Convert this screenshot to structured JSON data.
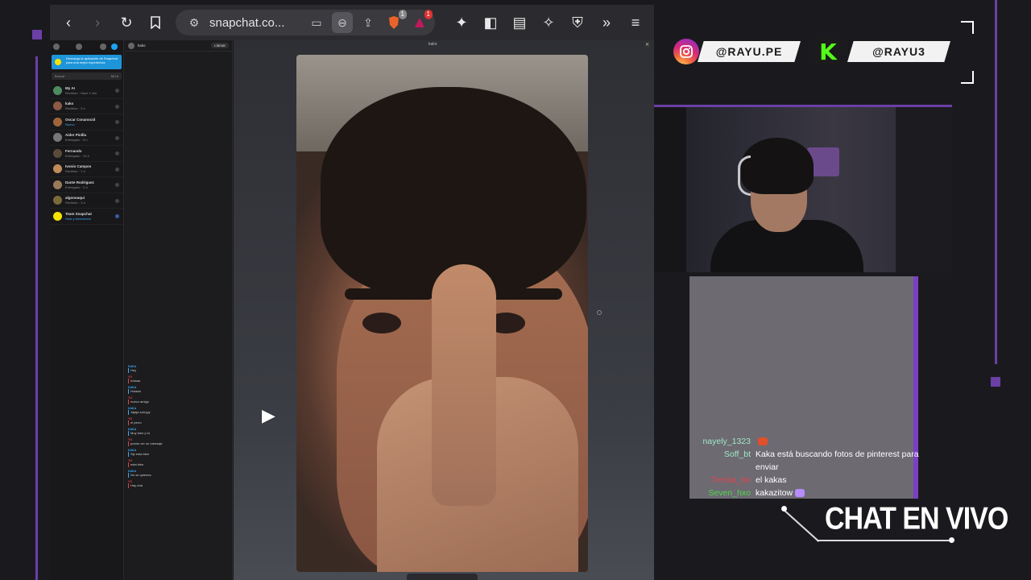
{
  "browser": {
    "url": "snapchat.co...",
    "ext_badge_1": "1",
    "ext_badge_2": "1"
  },
  "snapchat": {
    "banner": "Descarga la aplicación de Snapchat para una mejor experiencia",
    "search_placeholder": "Buscar",
    "search_right": "Mi IA",
    "chats": [
      {
        "name": "My AI",
        "status": "Recibido · Hace 1 min"
      },
      {
        "name": "kako",
        "status": "Recibido · 3 h"
      },
      {
        "name": "Oscar Conanocid",
        "status": "Nuevo"
      },
      {
        "name": "Aider Pinilla",
        "status": "Entregado · 5 h"
      },
      {
        "name": "Fernando",
        "status": "Entregado · 10 h"
      },
      {
        "name": "Ivonio Campos",
        "status": "Recibido · 1 d"
      },
      {
        "name": "Dante Rodriguez",
        "status": "Entregado · 2 d"
      },
      {
        "name": "algonoaqui",
        "status": "Recibido · 3 d"
      },
      {
        "name": "Team Snapchat",
        "status": "Hola y bienvenido"
      }
    ],
    "chat_header_name": "kako",
    "chat_header_pill": "Llamar",
    "viewer_title": "kako",
    "messages": [
      {
        "author": "KAKA",
        "text": "Hey",
        "red": false
      },
      {
        "author": "YO",
        "text": "holaaa",
        "red": true
      },
      {
        "author": "KAKA",
        "text": "Holaaa",
        "red": false
      },
      {
        "author": "YO",
        "text": "nuevo amigo",
        "red": true
      },
      {
        "author": "KAKA",
        "text": "Jajaja sorryyy",
        "red": false
      },
      {
        "author": "YO",
        "text": "el perro",
        "red": true
      },
      {
        "author": "KAKA",
        "text": "Muy bien y tú",
        "red": false
      },
      {
        "author": "YO",
        "text": "puedo ver un mensaje",
        "red": true
      },
      {
        "author": "KAKA",
        "text": "Sip esta bien",
        "red": false
      },
      {
        "author": "YO",
        "text": "esta bien",
        "red": true
      },
      {
        "author": "KAKA",
        "text": "No se quienes",
        "red": false
      },
      {
        "author": "YO",
        "text": "Hay real",
        "red": true
      }
    ]
  },
  "overlay": {
    "instagram_handle": "@RAYU.PE",
    "kick_handle": "@RAYU3",
    "chat_title": "CHAT EN VIVO",
    "colors": {
      "accent": "#6b3fa6",
      "chat_panel": "#7b3fc4"
    },
    "chat": [
      {
        "user": "nayely_1323",
        "color": "#9fe6c4",
        "text": "",
        "emote": "#e0502a"
      },
      {
        "user": "Soff_bt",
        "color": "#9fe6c4",
        "text": "Kaka está buscando fotos de pinterest para enviar",
        "emote": ""
      },
      {
        "user": "Tresita_bn",
        "color": "#e0454b",
        "text": "el kakas",
        "emote": ""
      },
      {
        "user": "Seven_hxo",
        "color": "#4ed64a",
        "text": "kakazitow",
        "emote": "#b78cff"
      }
    ]
  }
}
